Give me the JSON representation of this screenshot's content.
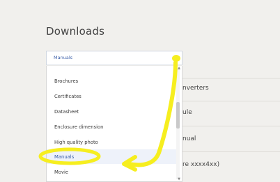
{
  "section": {
    "title": "Downloads"
  },
  "select": {
    "value": "Manuals"
  },
  "dropdown": {
    "options": [
      "Brochures",
      "Certificates",
      "Datasheet",
      "Enclosure dimension",
      "High quality photo",
      "Manuals",
      "Movie"
    ],
    "selected_index": 5
  },
  "background_items": [
    "nverters",
    "ule",
    "nual",
    "re xxxx4xx)"
  ],
  "colors": {
    "accent": "#3a5ea8",
    "annotation": "#f6ee1f"
  }
}
